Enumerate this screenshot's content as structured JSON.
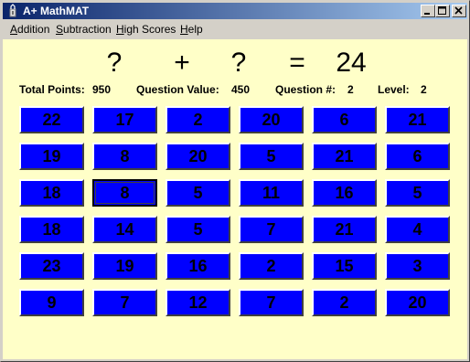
{
  "window": {
    "title": "A+ MathMAT"
  },
  "menu": [
    {
      "label": "Addition",
      "accel": "A",
      "rest": "ddition"
    },
    {
      "label": "Subtraction",
      "accel": "S",
      "rest": "ubtraction"
    },
    {
      "label": "High Scores",
      "accel": "H",
      "rest": "igh Scores"
    },
    {
      "label": "Help",
      "accel": "H",
      "rest": "elp"
    }
  ],
  "equation": {
    "operand_a": "?",
    "operator": "+",
    "operand_b": "?",
    "equals": "=",
    "result": "24"
  },
  "stats": {
    "total_points_label": "Total Points:",
    "total_points_value": "950",
    "question_value_label": "Question Value:",
    "question_value_value": "450",
    "question_num_label": "Question #:",
    "question_num_value": "2",
    "level_label": "Level:",
    "level_value": "2"
  },
  "grid": [
    [
      "22",
      "17",
      "2",
      "20",
      "6",
      "21"
    ],
    [
      "19",
      "8",
      "20",
      "5",
      "21",
      "6"
    ],
    [
      "18",
      "8",
      "5",
      "11",
      "16",
      "5"
    ],
    [
      "18",
      "14",
      "5",
      "7",
      "21",
      "4"
    ],
    [
      "23",
      "19",
      "16",
      "2",
      "15",
      "3"
    ],
    [
      "9",
      "7",
      "12",
      "7",
      "2",
      "20"
    ]
  ],
  "selected_tile": {
    "row": 2,
    "col": 1
  },
  "colors": {
    "tile_bg": "#0000ff",
    "client_bg": "#ffffc8",
    "title_bar_start": "#0a246a",
    "title_bar_end": "#a6caf0"
  }
}
